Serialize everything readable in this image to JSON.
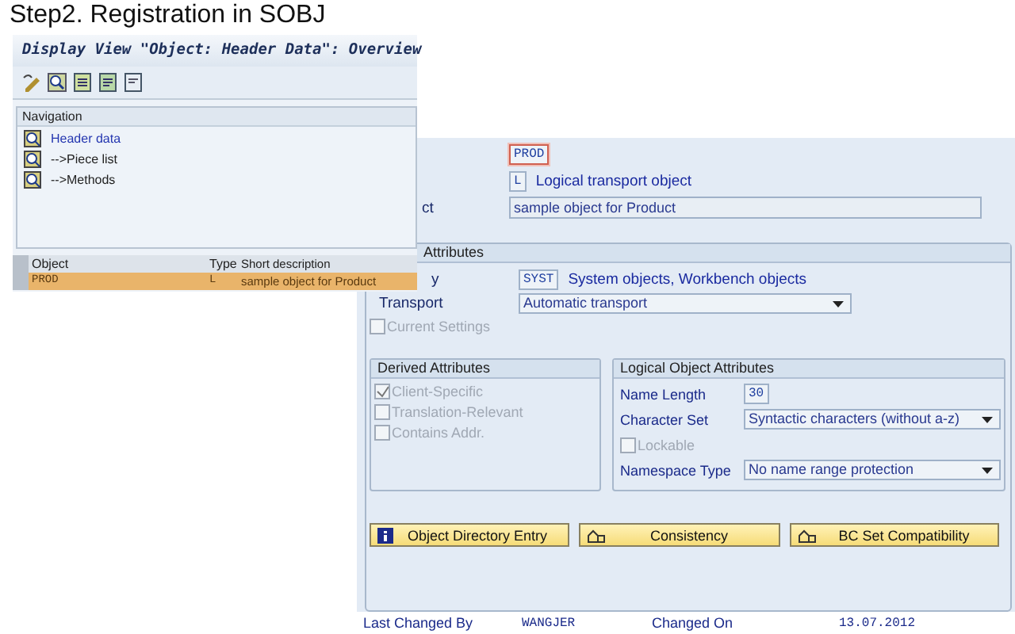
{
  "slide_title": "Step2. Registration in SOBJ",
  "left_window": {
    "title": "Display View \"Object: Header Data\": Overview",
    "navigation": {
      "title": "Navigation",
      "items": [
        {
          "label": "Header data",
          "selected": true
        },
        {
          "label": "-->Piece list",
          "selected": false
        },
        {
          "label": "-->Methods",
          "selected": false
        }
      ]
    },
    "table": {
      "columns": [
        "Object",
        "Type",
        "Short description"
      ],
      "rows": [
        {
          "cells": [
            "PROD",
            "L",
            "sample object for Product"
          ],
          "selected": true
        }
      ]
    }
  },
  "right_window": {
    "header_rows": [
      {
        "label": "",
        "code": "PROD",
        "focused": true,
        "text": ""
      },
      {
        "label": "",
        "code": "L",
        "focused": false,
        "text": "Logical transport object"
      },
      {
        "label": "ct",
        "field": "sample object for Product"
      }
    ],
    "attributes": {
      "title": "Attributes",
      "category": {
        "label": "y",
        "code": "SYST",
        "text": "System objects, Workbench objects"
      },
      "transport": {
        "label": "Transport",
        "value": "Automatic transport"
      },
      "current_settings": {
        "label": "Current Settings",
        "checked": false,
        "disabled": true
      },
      "derived": {
        "title": "Derived Attributes",
        "items": [
          {
            "label": "Client-Specific",
            "checked": true,
            "disabled": true
          },
          {
            "label": "Translation-Relevant",
            "checked": false,
            "disabled": true
          },
          {
            "label": "Contains Addr.",
            "checked": false,
            "disabled": true
          }
        ]
      },
      "logical": {
        "title": "Logical Object Attributes",
        "rows": [
          {
            "kind": "field",
            "label": "Name Length",
            "value": "30"
          },
          {
            "kind": "dropdown",
            "label": "Character Set",
            "value": "Syntactic characters (without a-z)"
          },
          {
            "kind": "checkbox",
            "label": "Lockable",
            "checked": false,
            "disabled": true
          },
          {
            "kind": "dropdown",
            "label": "Namespace Type",
            "value": "No name range protection"
          }
        ]
      },
      "buttons": [
        {
          "kind": "info",
          "label": "Object Directory Entry"
        },
        {
          "kind": "check",
          "label": "Consistency"
        },
        {
          "kind": "check",
          "label": "BC Set Compatibility"
        }
      ]
    },
    "footer": [
      {
        "kind": "label",
        "text": "Last Changed By"
      },
      {
        "kind": "value",
        "text": "WANGJER"
      },
      {
        "kind": "label",
        "text": "Changed On"
      },
      {
        "kind": "value",
        "text": "13.07.2012"
      }
    ]
  }
}
